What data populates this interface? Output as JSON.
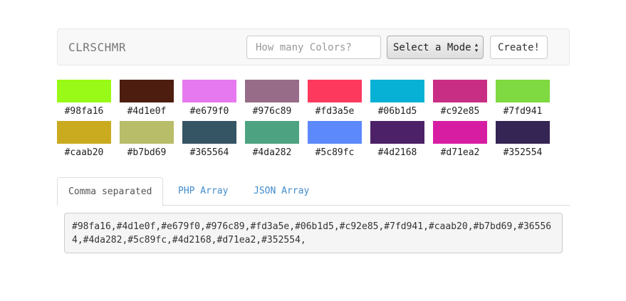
{
  "navbar": {
    "brand": "CLRSCHMR",
    "count_placeholder": "How many Colors?",
    "mode_select_value": "Select a Mode",
    "create_label": "Create!"
  },
  "swatches": [
    {
      "hex": "#98fa16",
      "label": "#98fa16"
    },
    {
      "hex": "#4d1e0f",
      "label": "#4d1e0f"
    },
    {
      "hex": "#e679f0",
      "label": "#e679f0"
    },
    {
      "hex": "#976c89",
      "label": "#976c89"
    },
    {
      "hex": "#fd3a5e",
      "label": "#fd3a5e"
    },
    {
      "hex": "#06b1d5",
      "label": "#06b1d5"
    },
    {
      "hex": "#c92e85",
      "label": "#c92e85"
    },
    {
      "hex": "#7fd941",
      "label": "#7fd941"
    },
    {
      "hex": "#caab20",
      "label": "#caab20"
    },
    {
      "hex": "#b7bd69",
      "label": "#b7bd69"
    },
    {
      "hex": "#365564",
      "label": "#365564"
    },
    {
      "hex": "#4da282",
      "label": "#4da282"
    },
    {
      "hex": "#5c89fc",
      "label": "#5c89fc"
    },
    {
      "hex": "#4d2168",
      "label": "#4d2168"
    },
    {
      "hex": "#d71ea2",
      "label": "#d71ea2"
    },
    {
      "hex": "#352554",
      "label": "#352554"
    }
  ],
  "tabs": [
    {
      "label": "Comma separated",
      "active": true
    },
    {
      "label": "PHP Array",
      "active": false
    },
    {
      "label": "JSON Array",
      "active": false
    }
  ],
  "output": {
    "text": "#98fa16,#4d1e0f,#e679f0,#976c89,#fd3a5e,#06b1d5,#c92e85,#7fd941,#caab20,#b7bd69,#365564,#4da282,#5c89fc,#4d2168,#d71ea2,#352554,"
  }
}
